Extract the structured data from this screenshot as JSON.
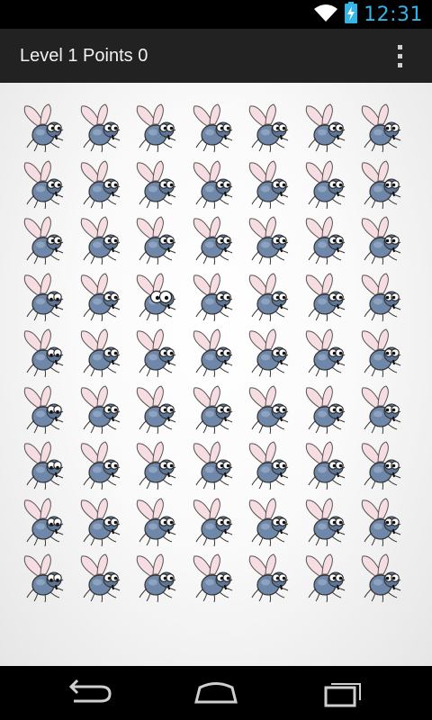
{
  "status_bar": {
    "time": "12:31",
    "icons": [
      "wifi-icon",
      "battery-charging-icon"
    ],
    "accent_color": "#33b5e5"
  },
  "action_bar": {
    "title": "Level 1 Points 0",
    "overflow_icon": "overflow-menu-icon"
  },
  "game": {
    "rows": 9,
    "columns": 7,
    "tile_icon": "fly-icon",
    "variants": [
      [
        0,
        0,
        0,
        0,
        0,
        0,
        3
      ],
      [
        0,
        0,
        0,
        0,
        0,
        0,
        3
      ],
      [
        0,
        0,
        0,
        0,
        0,
        0,
        3
      ],
      [
        2,
        0,
        1,
        0,
        0,
        0,
        3
      ],
      [
        2,
        0,
        0,
        0,
        0,
        0,
        3
      ],
      [
        2,
        0,
        0,
        0,
        0,
        0,
        3
      ],
      [
        2,
        0,
        0,
        0,
        0,
        0,
        3
      ],
      [
        2,
        0,
        0,
        0,
        0,
        0,
        3
      ],
      [
        2,
        0,
        0,
        0,
        0,
        0,
        3
      ]
    ],
    "variant_names": [
      "fly-looking-right",
      "fly-big-eyes",
      "fly-looking-down",
      "fly-looking-left"
    ]
  },
  "nav_bar": {
    "buttons": [
      "back-icon",
      "home-icon",
      "recent-apps-icon"
    ]
  }
}
